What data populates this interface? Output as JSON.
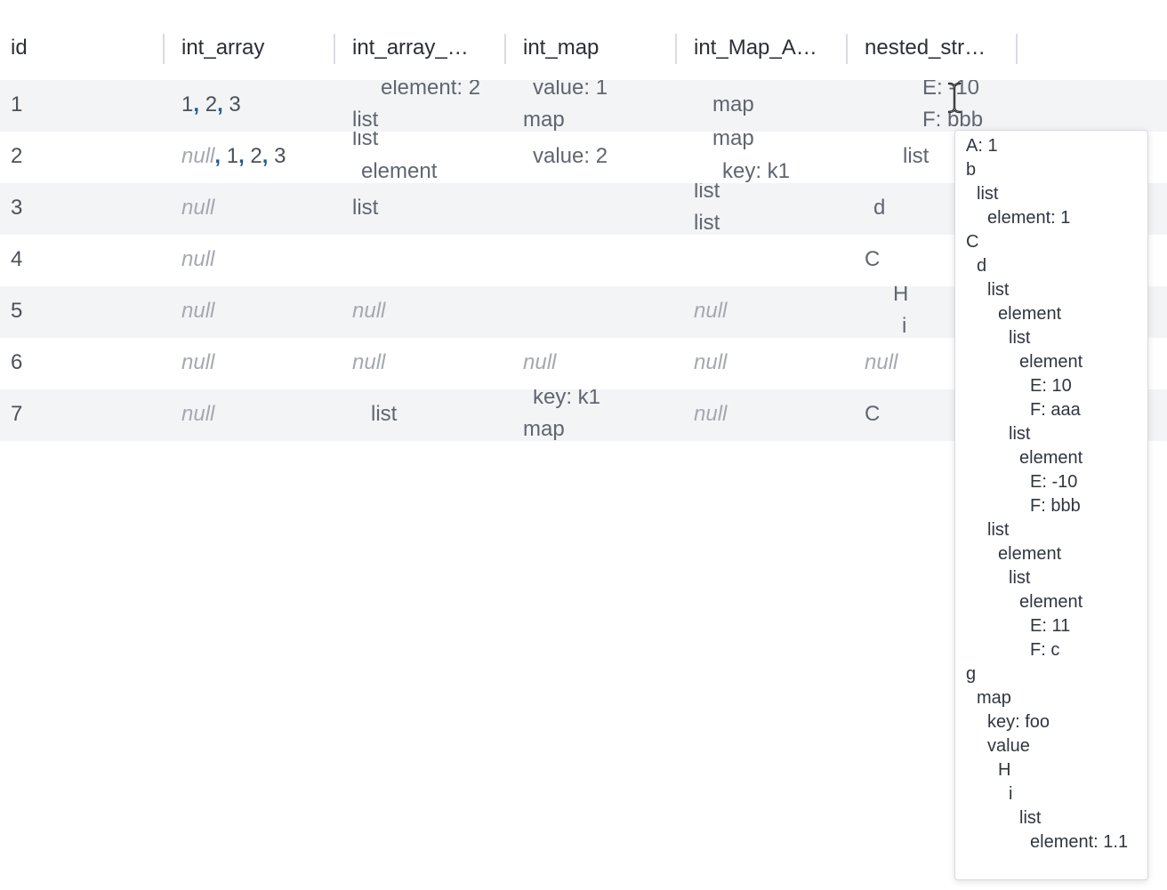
{
  "columns": [
    "id",
    "int_array",
    "int_array_…",
    "int_map",
    "int_Map_A…",
    "nested_str…"
  ],
  "null_text": "null",
  "int_array": {
    "r1": [
      "1",
      "2",
      "3"
    ],
    "r2": [
      "null",
      "1",
      "2",
      "3"
    ]
  },
  "cells": {
    "r1": {
      "id": "1",
      "c3a": "element: 2",
      "c3b": "list",
      "c4a": "value: 1",
      "c4b": "map",
      "c5a": "map",
      "c6a": "E: -10",
      "c6b": "F: bbb"
    },
    "r2": {
      "id": "2",
      "c3a": "list",
      "c3b": "element",
      "c4a": "value: 2",
      "c5a": "map",
      "c5b": "key: k1",
      "c6a": "list"
    },
    "r3": {
      "id": "3",
      "c3a": "list",
      "c5a": "list",
      "c5b": "list",
      "c6a": "d"
    },
    "r4": {
      "id": "4",
      "c6a": "C"
    },
    "r5": {
      "id": "5",
      "c6a": "H",
      "c6b": "i"
    },
    "r6": {
      "id": "6"
    },
    "r7": {
      "id": "7",
      "c3a": "list",
      "c4a": "key: k1",
      "c4b": "map",
      "c6a": "C"
    }
  },
  "tooltip_lines": [
    "A: 1",
    "b",
    "list",
    "element: 1",
    "C",
    "d",
    "list",
    "element",
    "list",
    "element",
    "E: 10",
    "F: aaa",
    "list",
    "element",
    "E: -10",
    "F: bbb",
    "list",
    "element",
    "list",
    "element",
    "E: 11",
    "F: c",
    "g",
    "map",
    "key: foo",
    "value",
    "H",
    "i",
    "list",
    "element: 1.1"
  ],
  "icons": {
    "cursor": "text-cursor-icon"
  }
}
